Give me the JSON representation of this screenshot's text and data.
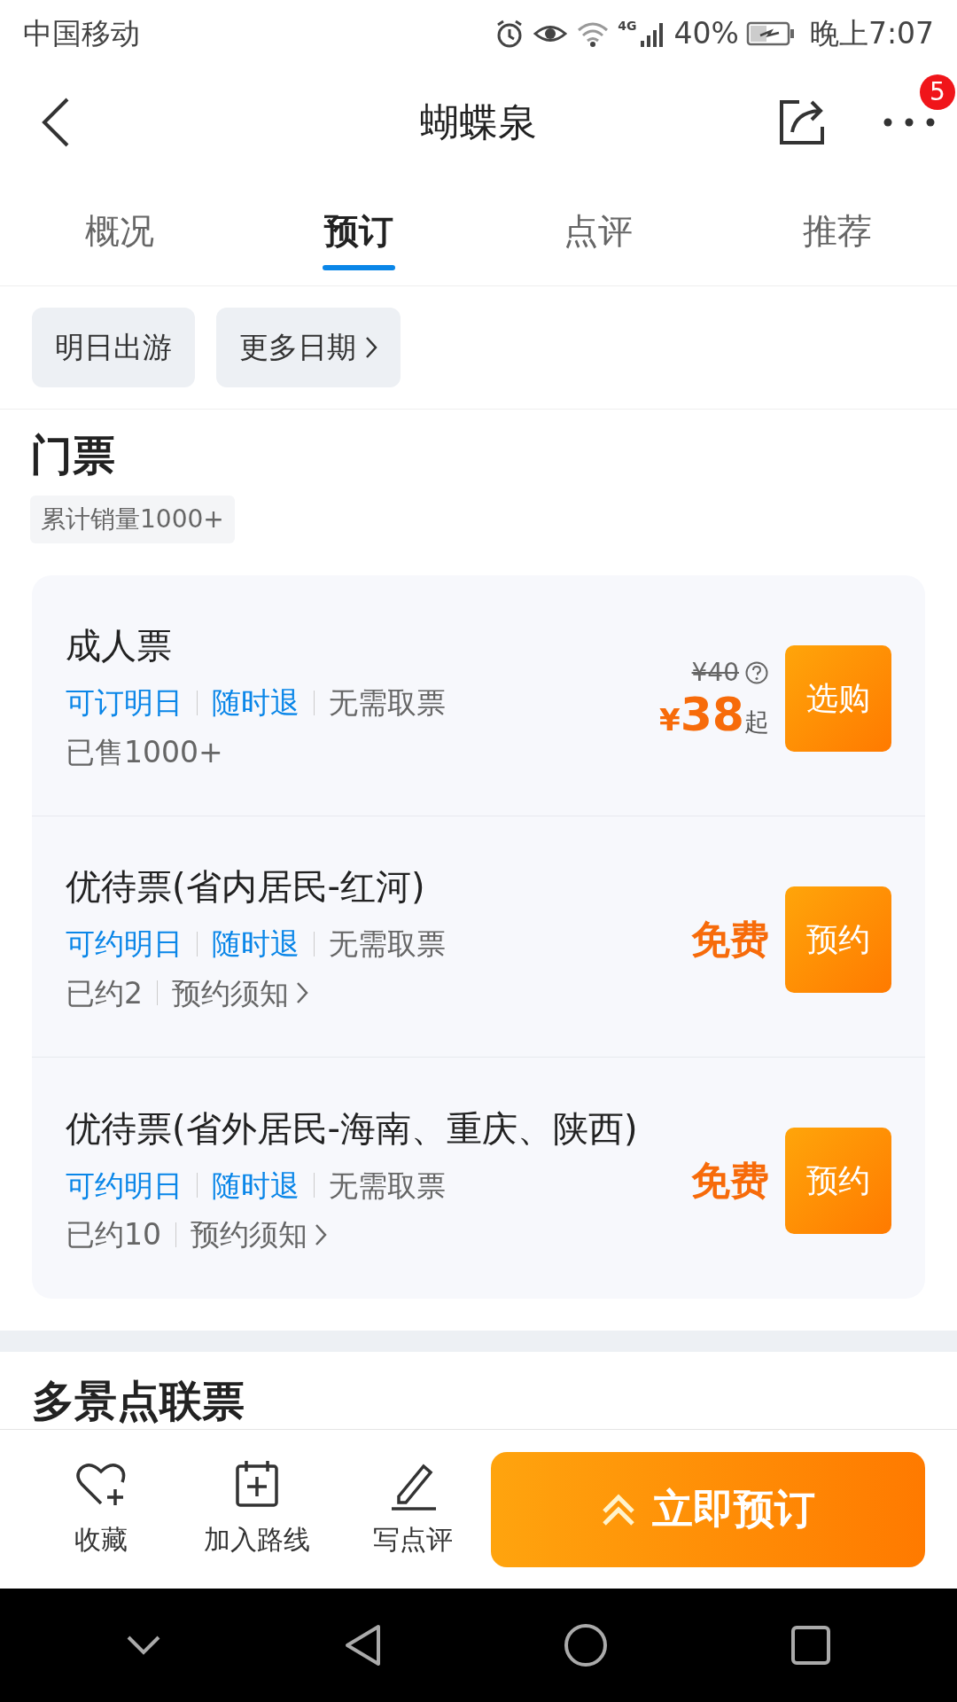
{
  "status_bar": {
    "carrier": "中国移动",
    "network": "4G",
    "battery": "40%",
    "time": "晚上7:07"
  },
  "header": {
    "title": "蝴蝶泉",
    "badge": "5"
  },
  "tabs": [
    {
      "label": "概况",
      "selected": false
    },
    {
      "label": "预订",
      "selected": true
    },
    {
      "label": "点评",
      "selected": false
    },
    {
      "label": "推荐",
      "selected": false
    }
  ],
  "date_chips": [
    {
      "label": "明日出游",
      "arrow": false
    },
    {
      "label": "更多日期",
      "arrow": true
    }
  ],
  "section": {
    "title": "门票",
    "tag": "累计销量1000+"
  },
  "tickets": [
    {
      "title": "成人票",
      "tags": [
        {
          "text": "可订明日",
          "kind": "highlight"
        },
        {
          "text": "随时退",
          "kind": "highlight"
        },
        {
          "text": "无需取票",
          "kind": "plain"
        }
      ],
      "sold": "已售1000+",
      "kind": "price",
      "original_price": "¥40",
      "currency": "¥",
      "amount": "38",
      "suffix": "起",
      "button": "选购"
    },
    {
      "title": "优待票(省内居民-红河)",
      "tags": [
        {
          "text": "可约明日",
          "kind": "highlight"
        },
        {
          "text": "随时退",
          "kind": "highlight"
        },
        {
          "text": "无需取票",
          "kind": "plain"
        }
      ],
      "sold": "已约2",
      "link": "预约须知",
      "kind": "free",
      "free_label": "免费",
      "button": "预约"
    },
    {
      "title": "优待票(省外居民-海南、重庆、陕西)",
      "tags": [
        {
          "text": "可约明日",
          "kind": "highlight"
        },
        {
          "text": "随时退",
          "kind": "highlight"
        },
        {
          "text": "无需取票",
          "kind": "plain"
        }
      ],
      "sold": "已约10",
      "link": "预约须知",
      "kind": "free",
      "free_label": "免费",
      "button": "预约"
    }
  ],
  "next_section": {
    "title": "多景点联票"
  },
  "bottom_bar": {
    "actions": [
      {
        "label": "收藏",
        "kind": "favorite"
      },
      {
        "label": "加入路线",
        "kind": "route"
      },
      {
        "label": "写点评",
        "kind": "review"
      }
    ],
    "book_button": "立即预订"
  }
}
